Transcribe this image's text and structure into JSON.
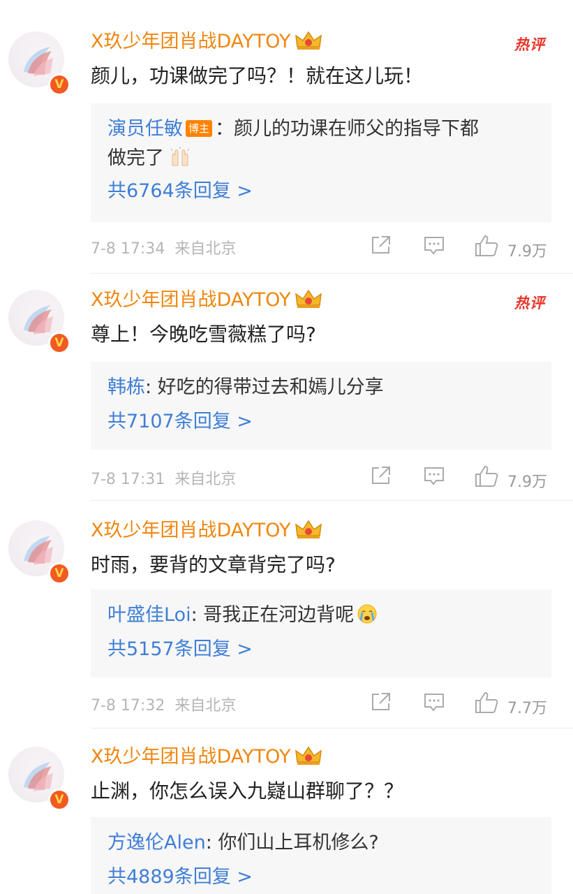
{
  "colors": {
    "username": "#f0860f",
    "reply_user": "#3f7ed6",
    "hot": "#e9362a",
    "badge": "#f15a22"
  },
  "comments": [
    {
      "username": "X玖少年团肖战DAYTOY",
      "hot_label": "热评",
      "text": "颜儿，功课做完了吗？！就在这儿玩！",
      "reply": {
        "user": "演员任敏",
        "tag": "博主",
        "content_line1": "：颜儿的功课在师父的指导下都",
        "content_line2": "做完了",
        "emoji": "raised-hands-icon"
      },
      "reply_count": "共6764条回复 >",
      "time": "7-8 17:34",
      "location": "来自北京",
      "likes": "7.9万"
    },
    {
      "username": "X玖少年团肖战DAYTOY",
      "hot_label": "热评",
      "text": "尊上！今晚吃雪薇糕了吗?",
      "reply": {
        "user": "韩栋",
        "content_line1": ": 好吃的得带过去和嫣儿分享"
      },
      "reply_count": "共7107条回复 >",
      "time": "7-8 17:31",
      "location": "来自北京",
      "likes": "7.9万"
    },
    {
      "username": "X玖少年团肖战DAYTOY",
      "text": "时雨，要背的文章背完了吗?",
      "reply": {
        "user": "叶盛佳Loi",
        "content_line1": ": 哥我正在河边背呢",
        "emoji": "crying-face-icon"
      },
      "reply_count": "共5157条回复 >",
      "time": "7-8 17:32",
      "location": "来自北京",
      "likes": "7.7万"
    },
    {
      "username": "X玖少年团肖战DAYTOY",
      "text": "止渊，你怎么误入九嶷山群聊了？？",
      "reply": {
        "user": "方逸伦Alen",
        "content_line1": ": 你们山上耳机修么?"
      },
      "reply_count": "共4889条回复 >"
    }
  ]
}
